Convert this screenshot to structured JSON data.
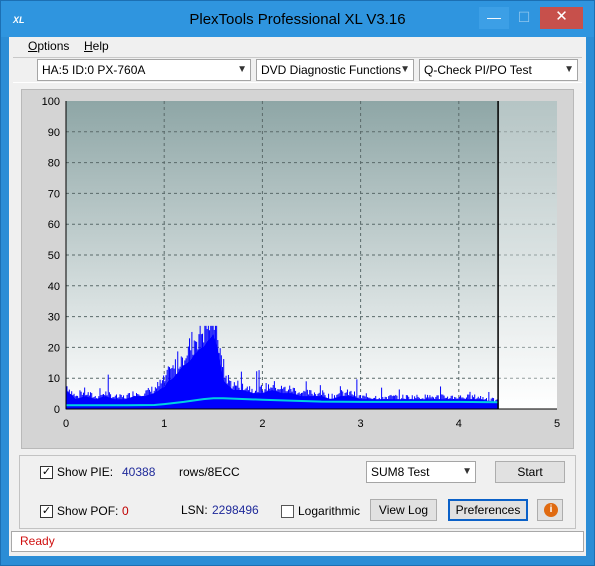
{
  "window": {
    "title": "PlexTools Professional XL V3.16",
    "icon_text": "XL",
    "controls": {
      "minimize": "—",
      "maximize": "☐",
      "close": "✕"
    }
  },
  "menu": {
    "items": [
      {
        "label": "Options",
        "accel": "O",
        "rest": "ptions"
      },
      {
        "label": "Help",
        "accel": "H",
        "rest": "elp"
      }
    ]
  },
  "toolbar": {
    "drive_select": "HA:5 ID:0  PX-760A",
    "function_select": "DVD Diagnostic Functions",
    "test_select": "Q-Check PI/PO Test"
  },
  "chart_data": {
    "type": "area",
    "xlim": [
      0,
      5
    ],
    "ylim": [
      0,
      100
    ],
    "x_ticks": [
      "0",
      "1",
      "2",
      "3",
      "4",
      "5"
    ],
    "y_ticks": [
      "0",
      "10",
      "20",
      "30",
      "40",
      "50",
      "60",
      "70",
      "80",
      "90",
      "100"
    ],
    "grid": true,
    "end_marker_x": 4.4,
    "series": [
      {
        "color": "#0000ff",
        "x": [
          0.0,
          0.1,
          0.2,
          0.3,
          0.4,
          0.5,
          0.6,
          0.7,
          0.8,
          0.9,
          1.0,
          1.05,
          1.1,
          1.15,
          1.2,
          1.25,
          1.3,
          1.35,
          1.4,
          1.45,
          1.5,
          1.55,
          1.6,
          1.7,
          1.8,
          1.9,
          2.0,
          2.1,
          2.2,
          2.3,
          2.4,
          2.5,
          2.6,
          2.7,
          2.8,
          2.9,
          3.0,
          3.2,
          3.4,
          3.6,
          3.8,
          4.0,
          4.2,
          4.4
        ],
        "values": [
          6,
          3,
          4,
          3,
          4,
          3,
          3,
          4,
          4,
          5,
          7,
          9,
          10,
          12,
          14,
          15,
          17,
          19,
          20,
          22,
          24,
          18,
          9,
          6,
          6,
          5,
          5,
          6,
          5,
          5,
          4,
          4,
          4,
          3,
          4,
          4,
          3,
          3,
          3,
          3,
          3,
          3,
          3,
          2
        ]
      },
      {
        "color": "#00d0e0",
        "x": [
          0.0,
          0.5,
          0.9,
          1.0,
          1.2,
          1.4,
          1.5,
          1.6,
          2.0,
          2.6,
          3.0,
          3.6,
          4.0,
          4.4
        ],
        "values": [
          1.2,
          1.2,
          1.3,
          1.6,
          2.3,
          3.2,
          3.5,
          3.5,
          3.0,
          2.4,
          2.3,
          2.3,
          2.3,
          2.2
        ]
      }
    ]
  },
  "controls": {
    "show_pie_label": "Show PIE:",
    "pie_value": "40388",
    "pie_unit": "rows/8ECC",
    "show_pof_label": "Show POF:",
    "pof_value": "0",
    "lsn_label": "LSN:",
    "lsn_value": "2298496",
    "logarithmic_label": "Logarithmic",
    "sum_select": "SUM8 Test",
    "start_button": "Start",
    "view_log_button": "View Log",
    "preferences_button": "Preferences",
    "info_glyph": "i",
    "check_glyph": "✓"
  },
  "status": {
    "text": "Ready"
  }
}
